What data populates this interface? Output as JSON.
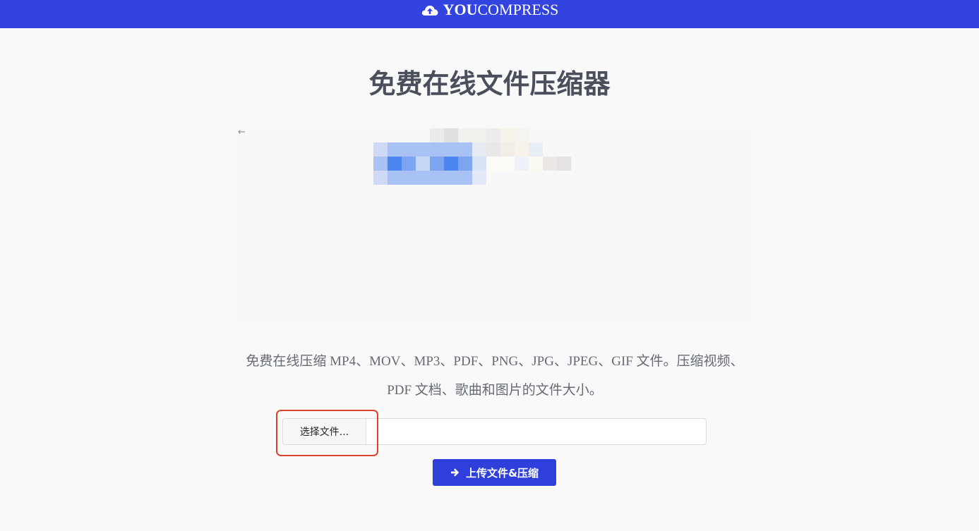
{
  "header": {
    "brand_bold": "YOU",
    "brand_rest": "COMPRESS",
    "logo_icon": "cloud-upload-icon",
    "background_color": "#3343e0"
  },
  "main": {
    "title": "免费在线文件压缩器",
    "ad_back_glyph": "←",
    "description": "免费在线压缩 MP4、MOV、MP3、PDF、PNG、JPG、JPEG、GIF 文件。压缩视频、PDF 文档、歌曲和图片的文件大小。",
    "file_input": {
      "button_label": "选择文件...",
      "file_name": ""
    },
    "upload_button": {
      "label": "上传文件&压缩",
      "icon": "arrow-right-icon",
      "color": "#2e3fdc"
    },
    "highlight_color": "#e0402e"
  }
}
